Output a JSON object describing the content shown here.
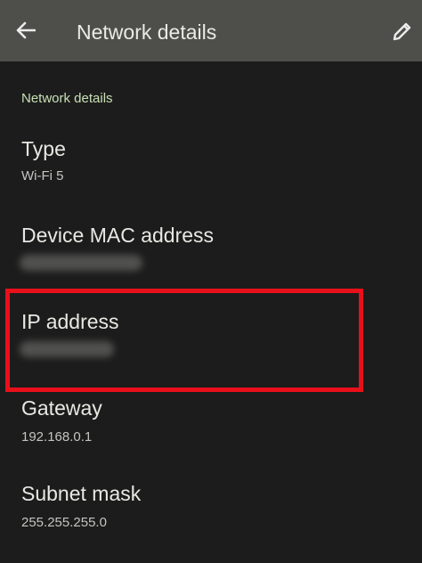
{
  "app_bar": {
    "title": "Network details",
    "back_icon": "arrow-back-icon",
    "edit_icon": "pencil-icon"
  },
  "section": {
    "header": "Network details"
  },
  "items": [
    {
      "title": "Type",
      "value": "Wi-Fi 5"
    },
    {
      "title": "Device MAC address",
      "value_blurred": true
    },
    {
      "title": "IP address",
      "value_blurred": true
    },
    {
      "title": "Gateway",
      "value": "192.168.0.1"
    },
    {
      "title": "Subnet mask",
      "value": "255.255.255.0"
    }
  ],
  "colors": {
    "app_bar_bg": "#4e4f4b",
    "background": "#1c1c1c",
    "section_header": "#c8e0b4",
    "highlight": "#e8101a"
  }
}
